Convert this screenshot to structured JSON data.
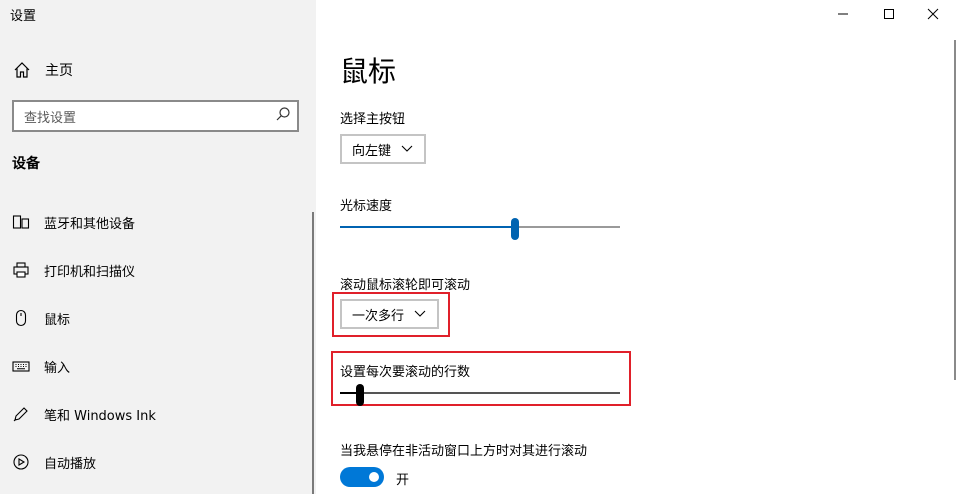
{
  "window": {
    "title": "设置",
    "controls": {
      "minimize_icon": "minimize-icon",
      "maximize_icon": "maximize-icon",
      "close_icon": "close-icon"
    }
  },
  "sidebar": {
    "home_label": "主页",
    "search_placeholder": "查找设置",
    "section_title": "设备",
    "items": [
      {
        "label": "蓝牙和其他设备",
        "icon": "bluetooth-devices-icon"
      },
      {
        "label": "打印机和扫描仪",
        "icon": "printer-icon"
      },
      {
        "label": "鼠标",
        "icon": "mouse-icon"
      },
      {
        "label": "输入",
        "icon": "keyboard-icon"
      },
      {
        "label": "笔和 Windows Ink",
        "icon": "pen-icon"
      },
      {
        "label": "自动播放",
        "icon": "autoplay-icon"
      }
    ]
  },
  "main": {
    "title": "鼠标",
    "primary_button": {
      "label": "选择主按钮",
      "value": "向左键"
    },
    "cursor_speed": {
      "label": "光标速度",
      "level_percent": 63
    },
    "wheel_scroll": {
      "label": "滚动鼠标滚轮即可滚动",
      "value": "一次多行"
    },
    "lines_per_scroll": {
      "label": "设置每次要滚动的行数",
      "level_percent": 6
    },
    "inactive_scroll": {
      "label": "当我悬停在非活动窗口上方时对其进行滚动",
      "state": "开"
    }
  },
  "colors": {
    "accent": "#0078d7",
    "highlight_border": "#e0202a",
    "sidebar_bg": "#f2f2f2"
  }
}
